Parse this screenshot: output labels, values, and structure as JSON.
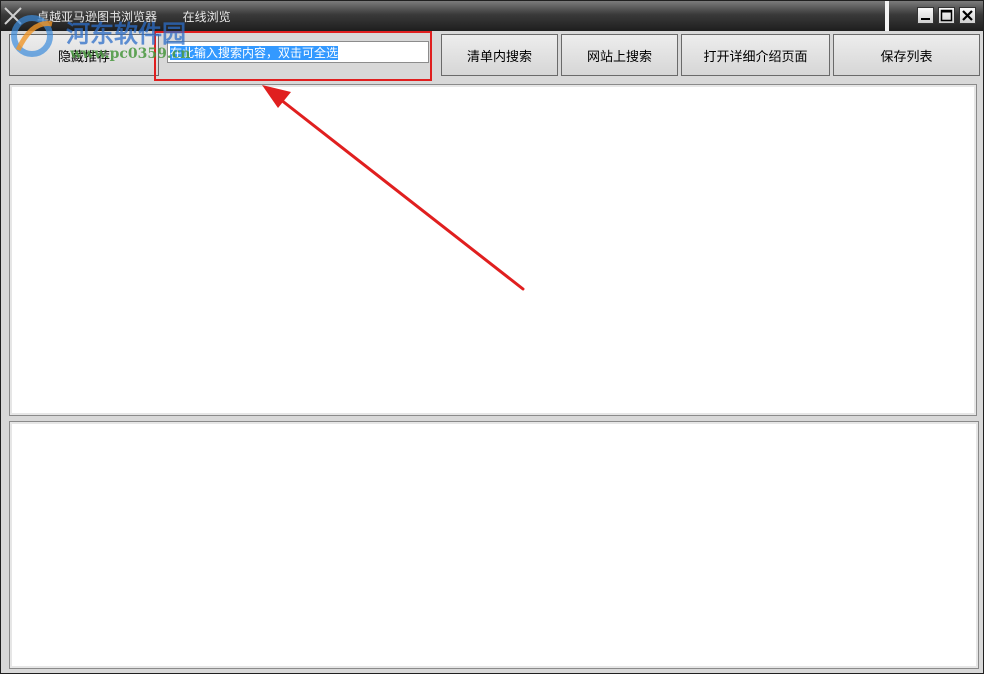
{
  "window": {
    "title": "卓越亚马逊图书浏览器",
    "subtitle": "在线浏览"
  },
  "toolbar": {
    "hide_recommend_label": "隐藏推荐",
    "search_placeholder": "在此输入搜索内容，双击可全选",
    "search_value": "在此输入搜索内容，双击可全选",
    "search_in_list_label": "清单内搜索",
    "search_web_label": "网站上搜索",
    "open_detail_label": "打开详细介绍页面",
    "save_list_label": "保存列表"
  },
  "watermark": {
    "title": "河东软件园",
    "url": "www.pc0359.cn"
  },
  "colors": {
    "annotation": "#e01f1f",
    "selection": "#3399ff",
    "watermark_blue": "#2c6ec8",
    "watermark_green": "#46963c"
  },
  "icons": {
    "app": "app-icon",
    "minimize": "minimize-icon",
    "maximize": "maximize-icon",
    "close": "close-icon"
  }
}
